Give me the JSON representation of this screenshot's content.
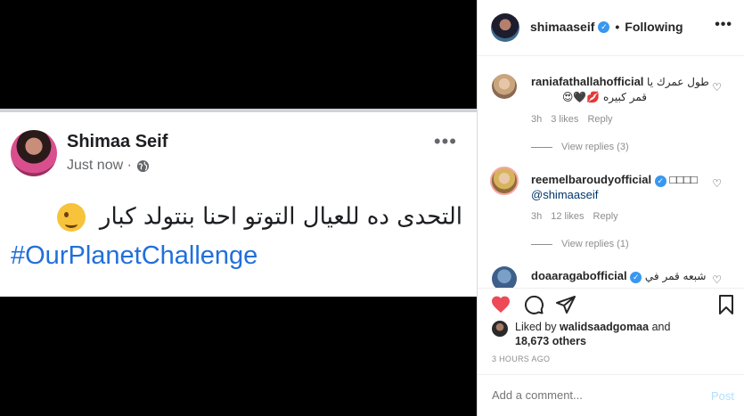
{
  "media": {
    "fb_post": {
      "author": "Shimaa Seif",
      "meta": "Just now ·",
      "more": "•••",
      "text": "التحدى ده للعيال التوتو احنا بنتولد كبار",
      "hashtag": "#OurPlanetChallenge"
    }
  },
  "header": {
    "username": "shimaaseif",
    "dot": "•",
    "follow_status": "Following",
    "more": "•••"
  },
  "comments": [
    {
      "username": "raniafathallahofficial",
      "text": "طول عمرك يا",
      "text2": "قمر كبيره 💋🖤😍",
      "time": "3h",
      "likes": "3 likes",
      "reply": "Reply",
      "view_replies": "View replies (3)"
    },
    {
      "username": "reemelbaroudyofficial",
      "text": "□□□□",
      "mention": "@shimaaseif",
      "time": "3h",
      "likes": "12 likes",
      "reply": "Reply",
      "view_replies": "View replies (1)"
    },
    {
      "username": "doaaragabofficial",
      "text": "شبعه قمر في كل"
    }
  ],
  "likes": {
    "prefix": "Liked by",
    "user": "walidsaadgomaa",
    "suffix": "and",
    "others": "18,673 others"
  },
  "timestamp": "3 HOURS AGO",
  "add_comment": {
    "placeholder": "Add a comment...",
    "post_label": "Post"
  },
  "colors": {
    "like_red": "#ed4956",
    "link_blue": "#00376b",
    "verified_blue": "#3897f0",
    "hashtag_blue": "#216fdb"
  }
}
